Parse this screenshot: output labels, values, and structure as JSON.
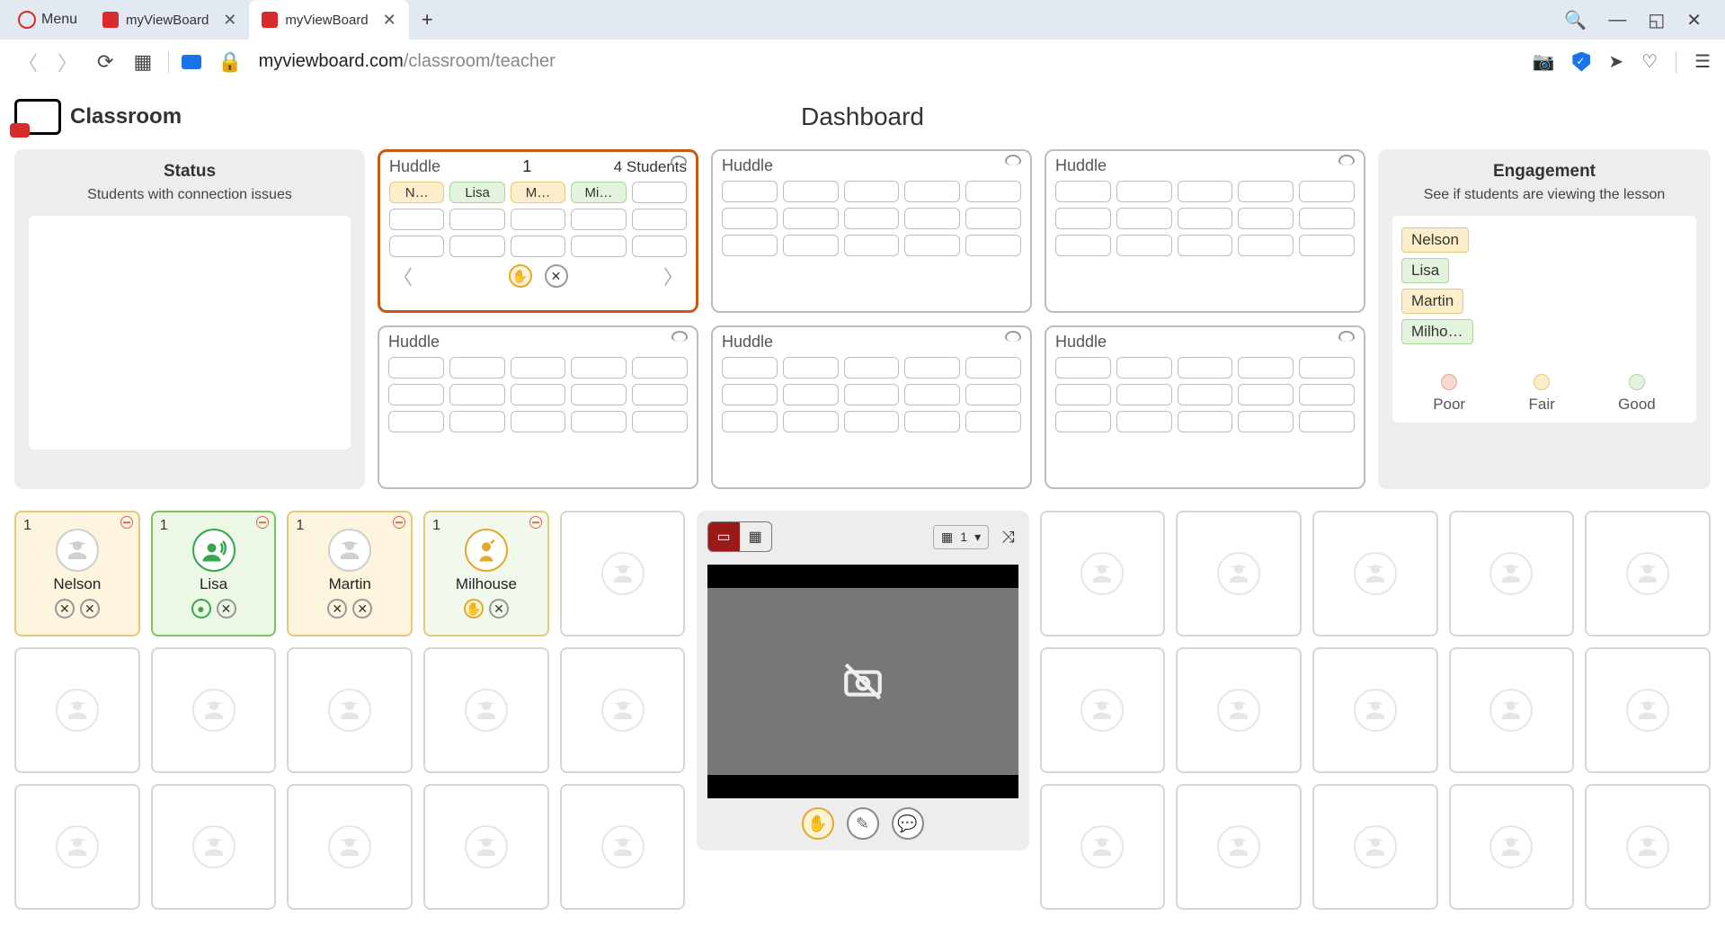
{
  "browser": {
    "menu_label": "Menu",
    "tabs": [
      {
        "title": "myViewBoard",
        "active": false
      },
      {
        "title": "myViewBoard",
        "active": true
      }
    ],
    "url_domain": "myviewboard.com",
    "url_path": "/classroom/teacher"
  },
  "header": {
    "app_name": "Classroom",
    "page_title": "Dashboard"
  },
  "status_panel": {
    "title": "Status",
    "subtitle": "Students with connection issues"
  },
  "huddles": [
    {
      "label": "Huddle",
      "number": "1",
      "count_label": "4 Students",
      "active": true,
      "members": [
        {
          "name": "N…",
          "tone": "yellow"
        },
        {
          "name": "Lisa",
          "tone": "green"
        },
        {
          "name": "M…",
          "tone": "yellow"
        },
        {
          "name": "Mi…",
          "tone": "green"
        }
      ]
    },
    {
      "label": "Huddle",
      "active": false
    },
    {
      "label": "Huddle",
      "active": false
    },
    {
      "label": "Huddle",
      "active": false
    },
    {
      "label": "Huddle",
      "active": false
    },
    {
      "label": "Huddle",
      "active": false
    }
  ],
  "engagement_panel": {
    "title": "Engagement",
    "subtitle": "See if students are viewing the lesson",
    "items": [
      {
        "name": "Nelson",
        "tone": "yellow"
      },
      {
        "name": "Lisa",
        "tone": "green"
      },
      {
        "name": "Martin",
        "tone": "yellow"
      },
      {
        "name": "Milho…",
        "tone": "green"
      }
    ],
    "legend": {
      "poor": "Poor",
      "fair": "Fair",
      "good": "Good"
    }
  },
  "students_left": [
    {
      "name": "Nelson",
      "group": "1",
      "tone": "yellow",
      "state": "normal"
    },
    {
      "name": "Lisa",
      "group": "1",
      "tone": "green",
      "state": "speaking"
    },
    {
      "name": "Martin",
      "group": "1",
      "tone": "yellow",
      "state": "normal"
    },
    {
      "name": "Milhouse",
      "group": "1",
      "tone": "green-outline",
      "state": "hand"
    }
  ],
  "presenter": {
    "selector_value": "1"
  }
}
